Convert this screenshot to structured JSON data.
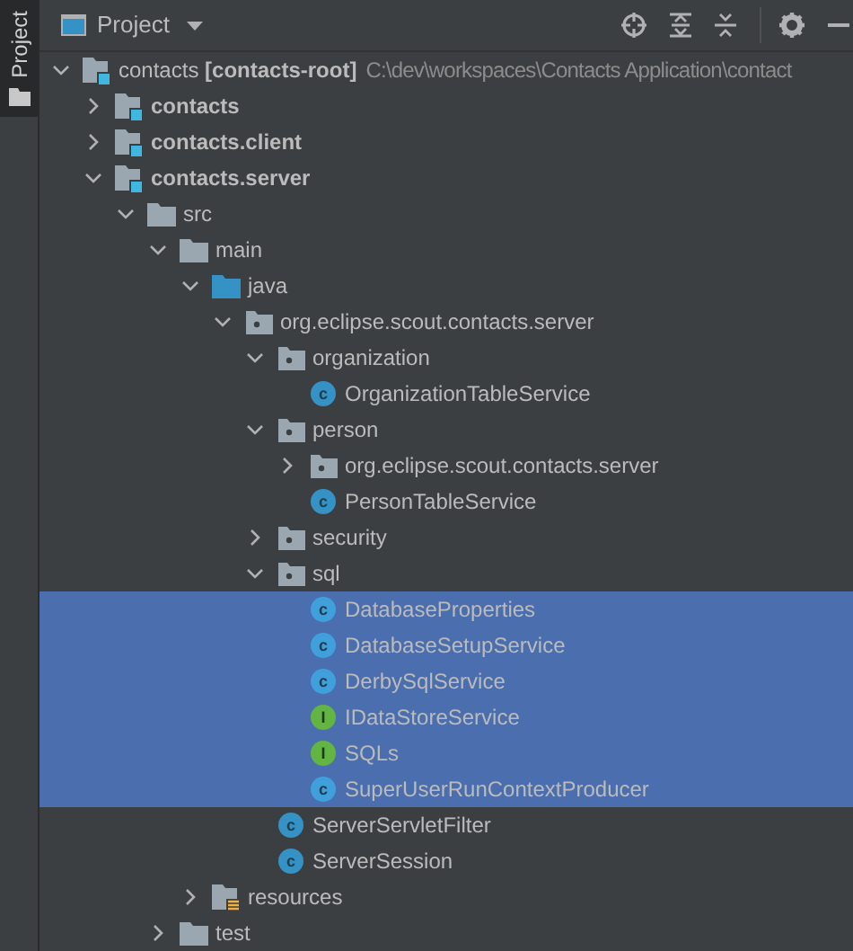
{
  "side_tab": {
    "label": "Project",
    "selected": true
  },
  "toolbar": {
    "title": "Project"
  },
  "tree": [
    {
      "kind": "module",
      "label": "contacts **[contacts-root]**",
      "location": "C:\\dev\\workspaces\\Contacts Application\\contact",
      "bold": false,
      "expanded": true,
      "selected": false,
      "children": [
        {
          "kind": "module",
          "label": "contacts",
          "bold": true,
          "expanded": false,
          "selected": false
        },
        {
          "kind": "module",
          "label": "contacts.client",
          "bold": true,
          "expanded": false,
          "selected": false
        },
        {
          "kind": "module",
          "label": "contacts.server",
          "bold": true,
          "expanded": true,
          "selected": false,
          "children": [
            {
              "kind": "folder",
              "label": "src",
              "bold": false,
              "expanded": true,
              "selected": false,
              "children": [
                {
                  "kind": "folder",
                  "label": "main",
                  "bold": false,
                  "expanded": true,
                  "selected": false,
                  "children": [
                    {
                      "kind": "source_folder",
                      "label": "java",
                      "bold": false,
                      "expanded": true,
                      "selected": false,
                      "children": [
                        {
                          "kind": "package",
                          "label": "org.eclipse.scout.contacts.server",
                          "bold": false,
                          "expanded": true,
                          "selected": false,
                          "children": [
                            {
                              "kind": "package",
                              "label": "organization",
                              "bold": false,
                              "expanded": true,
                              "selected": false,
                              "children": [
                                {
                                  "kind": "class",
                                  "badge": "c",
                                  "label": "OrganizationTableService",
                                  "bold": false,
                                  "selected": false
                                }
                              ]
                            },
                            {
                              "kind": "package",
                              "label": "person",
                              "bold": false,
                              "expanded": true,
                              "selected": false,
                              "children": [
                                {
                                  "kind": "package",
                                  "label": "org.eclipse.scout.contacts.server",
                                  "bold": false,
                                  "expanded": false,
                                  "selected": false
                                },
                                {
                                  "kind": "class",
                                  "badge": "c",
                                  "label": "PersonTableService",
                                  "bold": false,
                                  "selected": false
                                }
                              ]
                            },
                            {
                              "kind": "package",
                              "label": "security",
                              "bold": false,
                              "expanded": false,
                              "selected": false
                            },
                            {
                              "kind": "package",
                              "label": "sql",
                              "bold": false,
                              "expanded": true,
                              "selected": false,
                              "children": [
                                {
                                  "kind": "class",
                                  "badge": "c",
                                  "label": "DatabaseProperties",
                                  "bold": false,
                                  "selected": true
                                },
                                {
                                  "kind": "class",
                                  "badge": "c",
                                  "label": "DatabaseSetupService",
                                  "bold": false,
                                  "selected": true
                                },
                                {
                                  "kind": "class",
                                  "badge": "c",
                                  "label": "DerbySqlService",
                                  "bold": false,
                                  "selected": true
                                },
                                {
                                  "kind": "interface",
                                  "badge": "I",
                                  "label": "IDataStoreService",
                                  "bold": false,
                                  "selected": true
                                },
                                {
                                  "kind": "interface",
                                  "badge": "I",
                                  "label": "SQLs",
                                  "bold": false,
                                  "selected": true
                                },
                                {
                                  "kind": "class",
                                  "badge": "c",
                                  "label": "SuperUserRunContextProducer",
                                  "bold": false,
                                  "selected": true
                                }
                              ]
                            },
                            {
                              "kind": "class",
                              "badge": "c",
                              "label": "ServerServletFilter",
                              "bold": false,
                              "selected": false
                            },
                            {
                              "kind": "class",
                              "badge": "c",
                              "label": "ServerSession",
                              "bold": false,
                              "selected": false
                            }
                          ]
                        }
                      ]
                    },
                    {
                      "kind": "resources",
                      "label": "resources",
                      "bold": false,
                      "expanded": false,
                      "selected": false
                    }
                  ]
                },
                {
                  "kind": "folder",
                  "label": "test",
                  "bold": false,
                  "expanded": false,
                  "selected": false
                }
              ]
            }
          ]
        }
      ]
    }
  ]
}
